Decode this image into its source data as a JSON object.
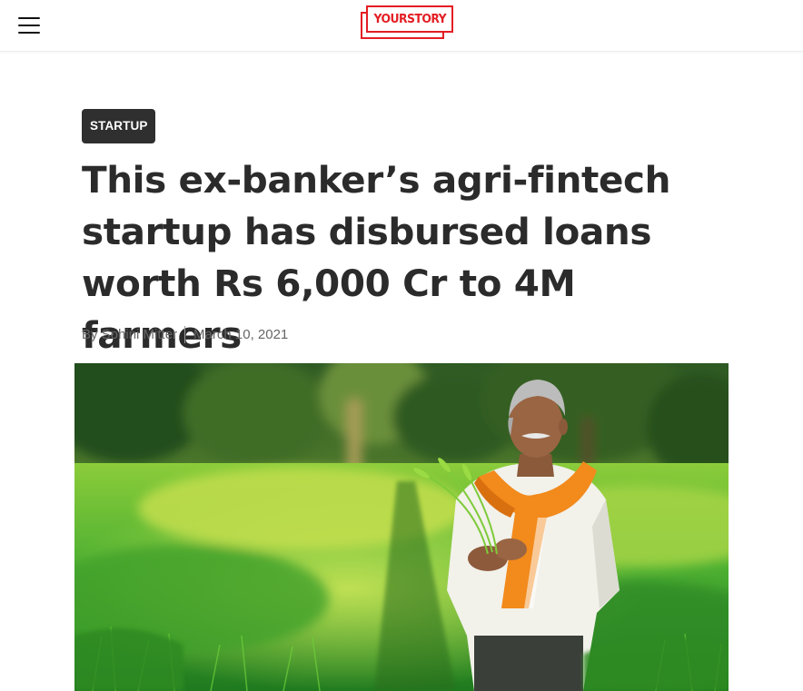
{
  "header": {
    "menu_icon": "hamburger-menu-icon",
    "logo_text": "YOURSTORY",
    "brand_color": "#e31e24"
  },
  "article": {
    "category": "STARTUP",
    "title": "This ex-banker’s agri-fintech startup has disbursed loans worth Rs 6,000 Cr to 4M farmers",
    "author": "By Sohini Mitter",
    "date": "March 10, 2021",
    "hero_image": "farmer-in-wheat-field-image"
  }
}
